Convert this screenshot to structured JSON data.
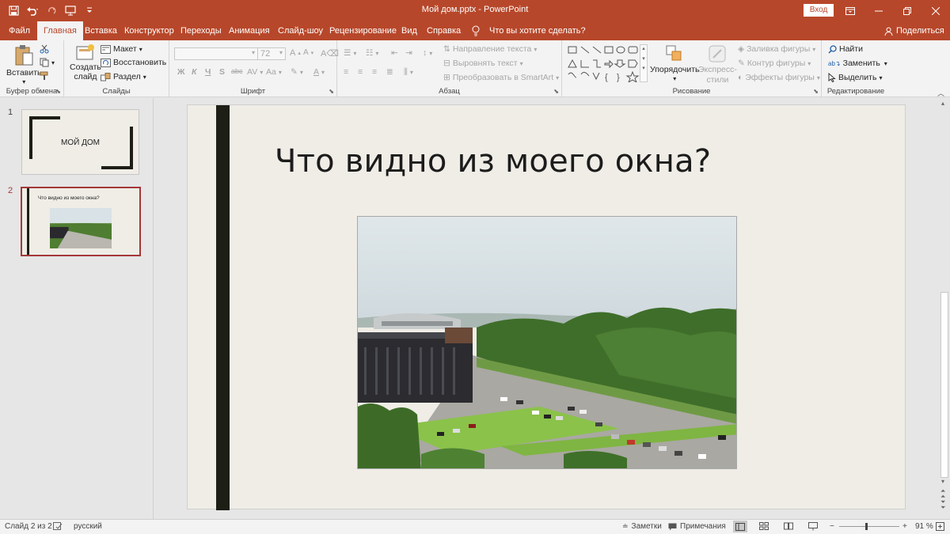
{
  "window": {
    "title": "Мой дом.pptx  -  PowerPoint",
    "signin_label": "Вход",
    "accent": "#b7472a"
  },
  "qat": [
    "save-icon",
    "undo-icon",
    "redo-icon",
    "start-from-beginning-icon",
    "customize-qat-icon"
  ],
  "tabs": [
    {
      "label": "Файл"
    },
    {
      "label": "Главная"
    },
    {
      "label": "Вставка"
    },
    {
      "label": "Конструктор"
    },
    {
      "label": "Переходы"
    },
    {
      "label": "Анимация"
    },
    {
      "label": "Слайд-шоу"
    },
    {
      "label": "Рецензирование"
    },
    {
      "label": "Вид"
    },
    {
      "label": "Справка"
    }
  ],
  "tell_me": "Что вы хотите сделать?",
  "share_label": "Поделиться",
  "ribbon": {
    "clipboard": {
      "paste": "Вставить",
      "label": "Буфер обмена"
    },
    "slides": {
      "new_slide_1": "Создать",
      "new_slide_2": "слайд",
      "layout": "Макет",
      "reset": "Восстановить",
      "section": "Раздел",
      "label": "Слайды"
    },
    "font": {
      "size": "72",
      "bold": "Ж",
      "italic": "К",
      "underline": "Ч",
      "strike": "S",
      "shadow": "abc",
      "spacing": "AV",
      "case": "Aa",
      "label": "Шрифт"
    },
    "paragraph": {
      "text_direction": "Направление текста",
      "align_text": "Выровнять текст",
      "smartart": "Преобразовать в SmartArt",
      "label": "Абзац"
    },
    "drawing": {
      "arrange": "Упорядочить",
      "quick_styles_1": "Экспресс-",
      "quick_styles_2": "стили",
      "fill": "Заливка фигуры",
      "outline": "Контур фигуры",
      "effects": "Эффекты фигуры",
      "label": "Рисование"
    },
    "editing": {
      "find": "Найти",
      "replace": "Заменить",
      "select": "Выделить",
      "label": "Редактирование"
    }
  },
  "slides_panel": [
    {
      "number": "1",
      "title": "МОЙ ДОМ"
    },
    {
      "number": "2",
      "title": "Что видно из моего окна?"
    }
  ],
  "slide": {
    "title": "Что видно из моего окна?"
  },
  "status": {
    "slide_counter": "Слайд 2 из 2",
    "language": "русский",
    "notes": "Заметки",
    "comments": "Примечания",
    "zoom": "91 %"
  }
}
